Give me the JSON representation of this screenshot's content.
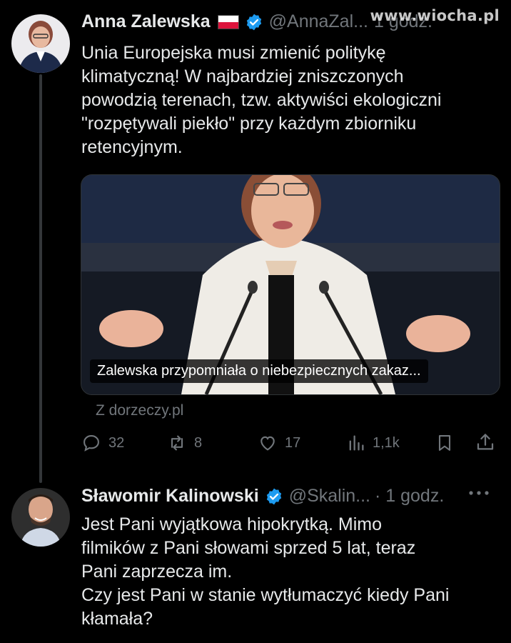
{
  "watermark": "www.wiocha.pl",
  "tweet1": {
    "author": "Anna Zalewska",
    "flag": "poland-flag",
    "handle": "@AnnaZal...",
    "time": "1 godz.",
    "text": "Unia Europejska musi zmienić politykę\nklimatyczną! W najbardziej zniszczonych\npowodzią terenach, tzw. aktywiści ekologiczni\n\"rozpętywali piekło\" przy każdym zbiorniku\nretencyjnym.",
    "media_caption": "Zalewska przypomniała o niebezpiecznych zakaz...",
    "source": "Z dorzeczy.pl",
    "stats": {
      "replies": "32",
      "reposts": "8",
      "likes": "17",
      "views": "1,1k"
    }
  },
  "tweet2": {
    "author": "Sławomir Kalinowski",
    "handle": "@Skalin...",
    "time": "· 1 godz.",
    "text": "Jest Pani wyjątkowa hipokrytką. Mimo\nfilmików z Pani słowami sprzed 5 lat, teraz\nPani zaprzecza im.\nCzy jest Pani w stanie wytłumaczyć kiedy Pani\nkłamała?"
  },
  "colors": {
    "background": "#000000",
    "text": "#e7e9ea",
    "muted": "#71767b",
    "verified": "#1d9bf0"
  }
}
